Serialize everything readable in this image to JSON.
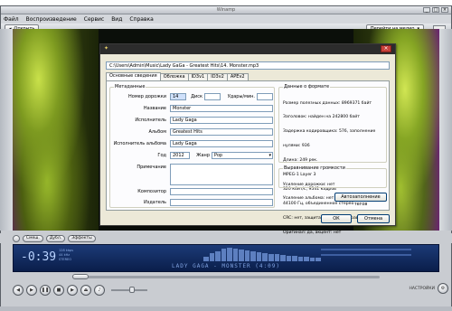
{
  "player": {
    "window_title": "Winamp",
    "menu": [
      "Файл",
      "Воспроизведение",
      "Сервис",
      "Вид",
      "Справка"
    ],
    "toolbar_left_btn": "Открыть",
    "toolbar_right_btn": "Перейти на медио",
    "row_buttons": [
      "Смеш.",
      "Дубл.",
      "Эффекты"
    ],
    "display": {
      "time": "-0:39",
      "info": [
        "128 kbps",
        "44 kHz",
        "STEREO"
      ],
      "track": "LADY GAGA - MONSTER (4:09)"
    },
    "right_label": "НАСТРОЙКИ"
  },
  "dialog": {
    "path": "C:\\Users\\Admin\\Music\\Lady GaGa - Greatest Hits\\14. Monster.mp3",
    "tabs": [
      "Основные сведения",
      "Обложка",
      "ID3v1",
      "ID3v2",
      "APEv2"
    ],
    "active_tab": 0,
    "metadata_group": "Метаданные",
    "fields": {
      "track_label": "Номер дорожки",
      "track_value": "14",
      "disc_label": "Диск",
      "disc_value": "",
      "bpm_label": "Удары/мин.",
      "bpm_value": "",
      "title_label": "Название",
      "title_value": "Monster",
      "artist_label": "Исполнитель",
      "artist_value": "Lady Gaga",
      "album_label": "Альбом",
      "album_value": "Greatest Hits",
      "album_artist_label": "Исполнитель альбома",
      "album_artist_value": "Lady Gaga",
      "year_label": "Год",
      "year_value": "2012",
      "genre_label": "Жанр",
      "genre_value": "Pop",
      "comment_label": "Примечание",
      "comment_value": "",
      "composer_label": "Композитор",
      "composer_value": "",
      "publisher_label": "Издатель",
      "publisher_value": ""
    },
    "format_group": "Данные о формате",
    "format_lines": [
      "Размер полезных данных: 8969371 байт",
      "Заголовок: найден на 242800 байт",
      "Задержка кодировщика: 576, заполнение",
      "нулями: 936",
      "Длина: 249 рек.",
      "MPEG-1 Layer 3",
      "320 кбит/с, 9541 кадров",
      "44100 Гц, объединенное стерео",
      "CRC: нет, защита авторского права: нет",
      "Оригинал: да, акцент: нет"
    ],
    "gain_group": "Выравнивание громкости",
    "gain_lines": [
      "Усиление дорожки: нет",
      "Усиление альбома: нет"
    ],
    "autofill_btn": "Автозаполнение тегов",
    "ok_btn": "ОК",
    "cancel_btn": "Отмена"
  }
}
